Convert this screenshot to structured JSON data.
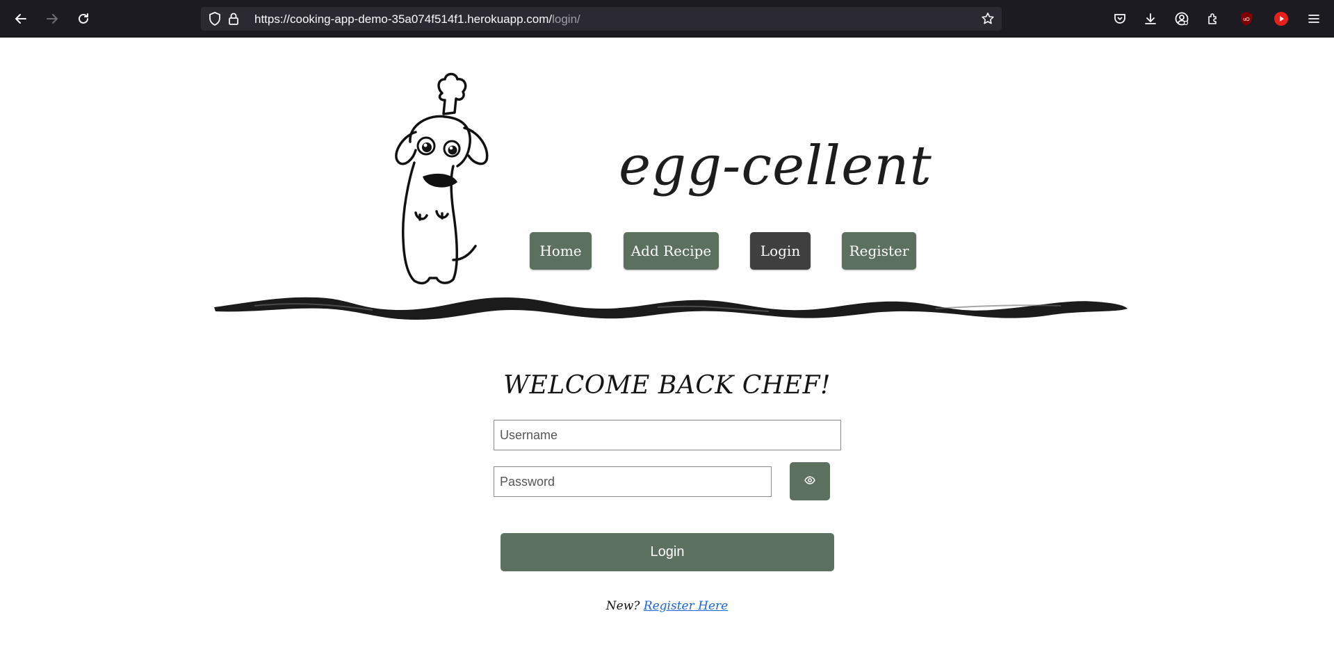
{
  "browser": {
    "url_main": "https://cooking-app-demo-35a074f514f1.herokuapp.com/",
    "url_path": "login/",
    "icons": {
      "back": "back-arrow-icon",
      "forward": "forward-arrow-icon",
      "reload": "reload-icon",
      "shield": "shield-icon",
      "lock": "lock-icon",
      "star": "bookmark-star-icon",
      "pocket": "pocket-icon",
      "download": "download-icon",
      "account": "account-icon",
      "extensions": "extensions-icon",
      "ublock": "ublock-icon",
      "youtube": "youtube-icon",
      "menu": "hamburger-menu-icon"
    }
  },
  "site": {
    "brand": "egg-cellent",
    "nav": [
      {
        "label": "Home",
        "active": false
      },
      {
        "label": "Add Recipe",
        "active": false
      },
      {
        "label": "Login",
        "active": true
      },
      {
        "label": "Register",
        "active": false
      }
    ],
    "colors": {
      "nav_button": "#5c7060",
      "nav_button_active": "#3f3f3f",
      "primary_button": "#5c7060",
      "link": "#1a66d6"
    }
  },
  "login": {
    "heading": "WELCOME BACK CHEF!",
    "username_placeholder": "Username",
    "password_placeholder": "Password",
    "show_password_icon": "eye-icon",
    "submit_label": "Login",
    "new_prefix": "New?",
    "register_link": "Register Here"
  }
}
